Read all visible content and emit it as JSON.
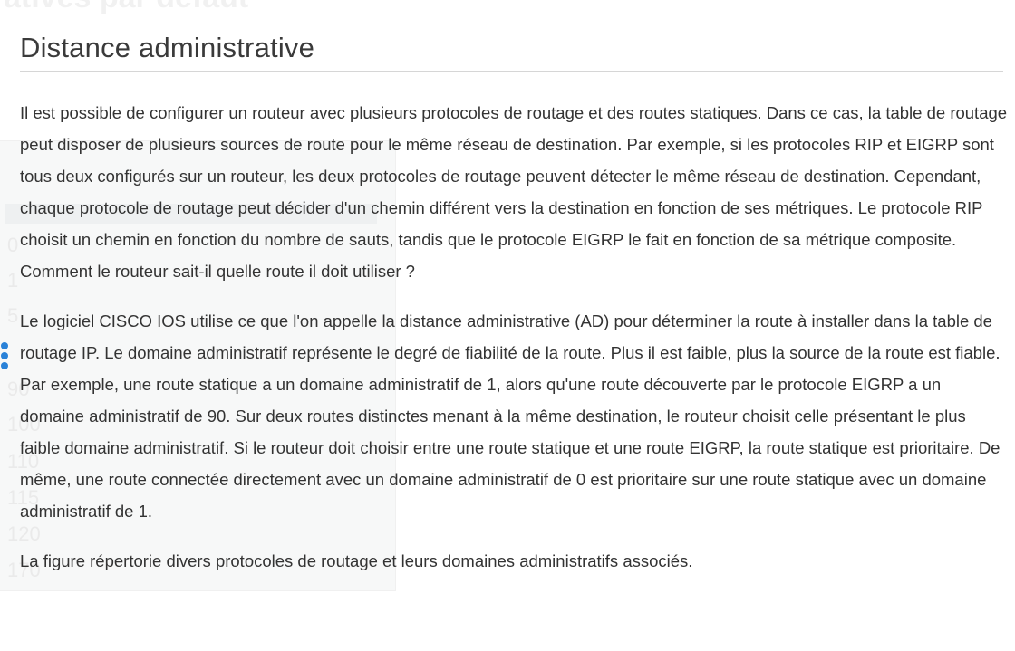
{
  "ghost": {
    "heading": "atives par défaut",
    "numbers": [
      "0",
      "1",
      "5",
      "90",
      "100",
      "110",
      "115",
      "120",
      "170"
    ]
  },
  "section": {
    "title": "Distance administrative"
  },
  "paragraphs": [
    "Il est possible de configurer un routeur avec plusieurs protocoles de routage et des routes statiques. Dans ce cas, la table de routage peut disposer de plusieurs sources de route pour le même réseau de destination. Par exemple, si les protocoles RIP et EIGRP sont tous deux configurés sur un routeur, les deux protocoles de routage peuvent détecter le même réseau de destination. Cependant, chaque protocole de routage peut décider d'un chemin différent vers la destination en fonction de ses métriques. Le protocole RIP choisit un chemin en fonction du nombre de sauts, tandis que le protocole EIGRP le fait en fonction de sa métrique composite. Comment le routeur sait-il quelle route il doit utiliser ?",
    "Le logiciel CISCO IOS utilise ce que l'on appelle la distance administrative (AD) pour déterminer la route à installer dans la table de routage IP. Le domaine administratif représente le degré de fiabilité de la route. Plus il est faible, plus la source de la route est fiable. Par exemple, une route statique a un domaine administratif de 1, alors qu'une route découverte par le protocole EIGRP a un domaine administratif de 90. Sur deux routes distinctes menant à la même destination, le routeur choisit celle présentant le plus faible domaine administratif. Si le routeur doit choisir entre une route statique et une route EIGRP, la route statique est prioritaire. De même, une route connectée directement avec un domaine administratif de 0 est prioritaire sur une route statique avec un domaine administratif de 1.",
    "La figure répertorie divers protocoles de routage et leurs domaines administratifs associés."
  ],
  "colors": {
    "accent": "#2a82d8",
    "text": "#333333",
    "rule": "#d6d6d6"
  }
}
